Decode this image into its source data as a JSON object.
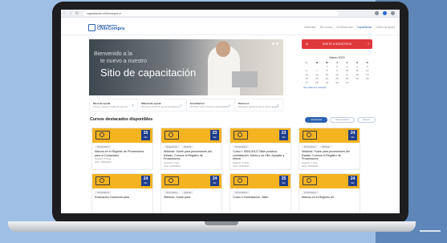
{
  "browser": {
    "url": "capacitacion.chilecompra.cl",
    "nav_back": "‹",
    "nav_forward": "›",
    "nav_reload": "↻"
  },
  "header": {
    "logo_small": "Capacitación",
    "logo_big": "ChileCompra",
    "nav": [
      "Ambientes",
      "Mis cursos",
      "Certificaciones",
      "Capacitación",
      "Centro de Ayuda"
    ],
    "active_index": 3
  },
  "hero": {
    "line1": "Bienvenido a la",
    "line2": "te nuevo a nuestro",
    "line3": "Sitio de capacitación"
  },
  "info": [
    {
      "title": "Mesa de ayuda",
      "sub": "Conoce nuestros canales de atención"
    },
    {
      "title": "Manual de ayuda",
      "sub": "Revisa el manual de uso de la plataforma"
    },
    {
      "title": "Acreditación",
      "sub": "Infórmate sobre el proceso de acreditación"
    },
    {
      "title": "Recursos",
      "sub": "Descarga material de apoyo para tu gestión"
    }
  ],
  "side": {
    "button": "ÚNETE A NOSOTROS",
    "calendar_title": "Marzo 2023",
    "weekdays": [
      "L",
      "M",
      "M",
      "J",
      "V",
      "S",
      "D"
    ],
    "days": [
      "",
      "",
      "1",
      "2",
      "3",
      "4",
      "5",
      "6",
      "7",
      "8",
      "9",
      "10",
      "11",
      "12",
      "13",
      "14",
      "15",
      "16",
      "17",
      "18",
      "19",
      "20",
      "21",
      "22",
      "23",
      "24",
      "25",
      "26",
      "27",
      "28",
      "29",
      "30",
      "31",
      "",
      ""
    ],
    "more": "Ver todos los eventos"
  },
  "section": {
    "title": "Cursos destacados disponibles",
    "filters": [
      "Destacados",
      "Más populares",
      "Nuevos"
    ]
  },
  "cards": [
    {
      "day": "15",
      "month": "Mar",
      "tags": [
        "Compradores"
      ],
      "title": "Marcos en el Registro de Proveedores para el Comprador",
      "meta1": "Duración: 6 horas",
      "meta2": "Inicio: 15/03/2023"
    },
    {
      "day": "23",
      "month": "Mar",
      "tags": [
        "Proveedores",
        "Webinar"
      ],
      "title": "Webinar: Sobre para proveedores del Estado. Conoce el Registro de Proveedores",
      "meta1": "Duración: 1 hora",
      "meta2": "Inicio: 23/03/2023"
    },
    {
      "day": "23",
      "month": "Mar",
      "tags": [
        "Compradores"
      ],
      "title": "Curso 1 SENCE/LO Taller práctico: contratación, Marco y su Hito: Apóyate y ofrece",
      "meta1": "Duración: 8 horas",
      "meta2": "Inicio: 23/03/2023"
    },
    {
      "day": "24",
      "month": "Mar",
      "tags": [
        "Proveedores",
        "Webinar"
      ],
      "title": "Webinar: Sobre para proveedores del Estado. Conoce el Registro de Proveedores",
      "meta1": "Duración: 1 hora",
      "meta2": "Inicio: 24/03/2023"
    },
    {
      "day": "24",
      "month": "Mar",
      "tags": [
        "Compradores"
      ],
      "title": "Evaluación Comercial para",
      "meta1": "",
      "meta2": ""
    },
    {
      "day": "24",
      "month": "Mar",
      "tags": [
        "Proveedores",
        "Webinar"
      ],
      "title": "Webinar: Sobre para",
      "meta1": "",
      "meta2": ""
    },
    {
      "day": "25",
      "month": "Mar",
      "tags": [
        "Compradores"
      ],
      "title": "Curso 4 Contratación: Taller",
      "meta1": "",
      "meta2": ""
    },
    {
      "day": "24",
      "month": "Mar",
      "tags": [
        "Compradores"
      ],
      "title": "Marcos en el Registro de",
      "meta1": "",
      "meta2": ""
    }
  ]
}
